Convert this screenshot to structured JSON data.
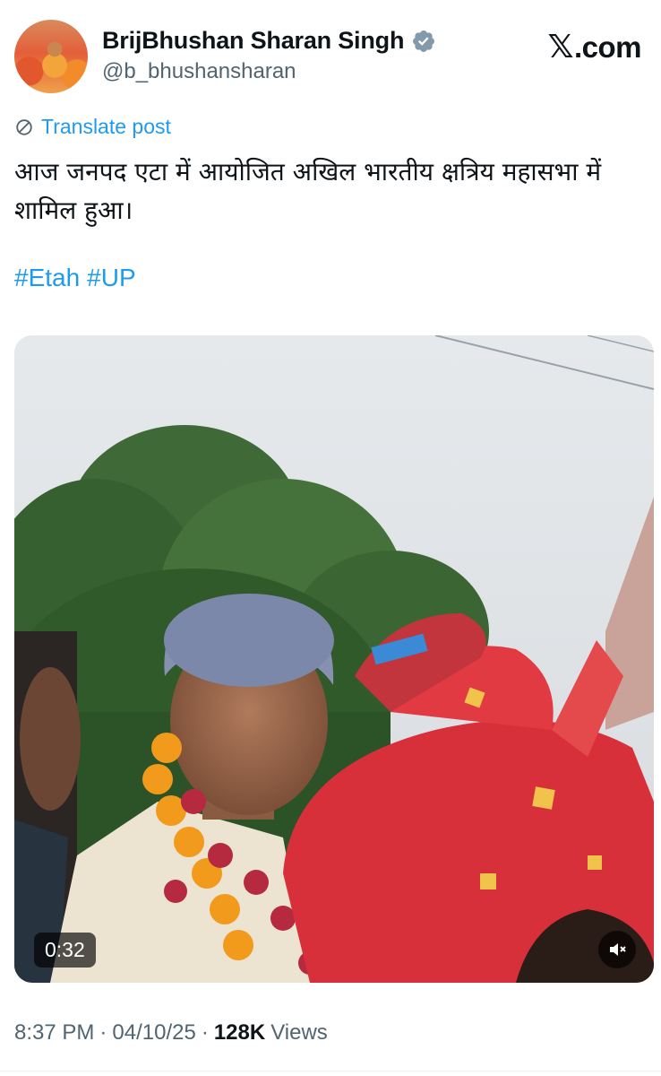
{
  "author": {
    "name": "BrijBhushan Sharan Singh",
    "handle": "@b_bhushansharan",
    "verified": true
  },
  "brand": {
    "label": ".com",
    "logo_icon": "x-logo-icon"
  },
  "translate": {
    "label": "Translate post",
    "icon": "globe-icon"
  },
  "post": {
    "text": "आज जनपद एटा में आयोजित अखिल भारतीय क्षत्रिय महासभा में शामिल हुआ।",
    "hashtags": [
      "#Etah",
      "#UP"
    ]
  },
  "media": {
    "type": "video",
    "duration": "0:32",
    "mute_icon": "muted-speaker-icon"
  },
  "meta": {
    "time": "8:37 PM",
    "separator": "·",
    "date": "04/10/25",
    "views_count": "128K",
    "views_label": "Views"
  },
  "colors": {
    "accent": "#1d9bf0",
    "text": "#0f1419",
    "secondary": "#536471"
  }
}
